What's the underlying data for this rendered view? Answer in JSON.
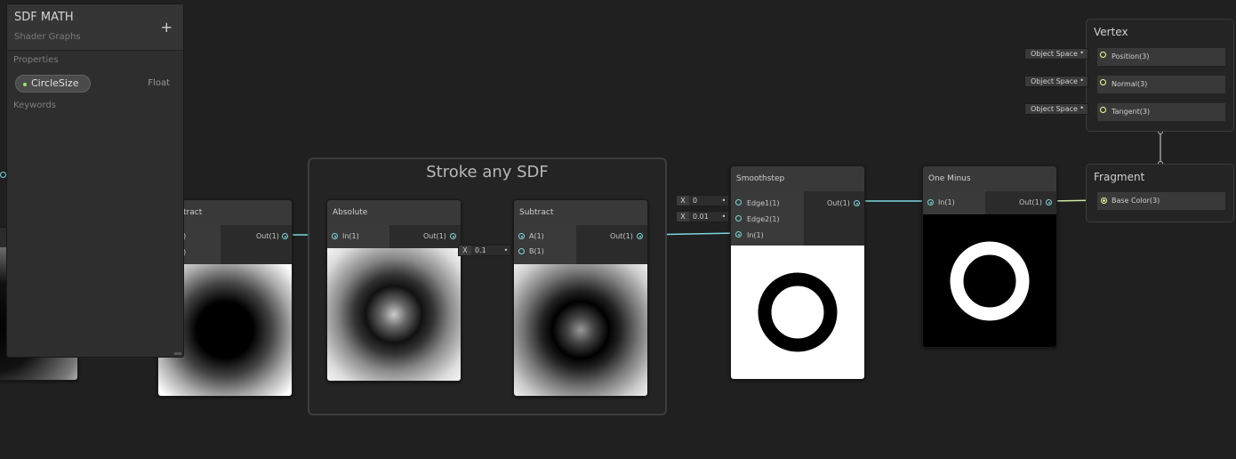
{
  "blackboard": {
    "title": "SDF MATH",
    "subtitle": "Shader Graphs",
    "add_label": "+",
    "properties_label": "Properties",
    "property": {
      "name": "CircleSize",
      "type": "Float"
    },
    "keywords_label": "Keywords"
  },
  "group": {
    "title": "Stroke any SDF"
  },
  "nodes": {
    "subtract1": {
      "title": "tract",
      "out": "Out(1)",
      "in_a": ")",
      "in_b": ")"
    },
    "absolute": {
      "title": "Absolute",
      "in": "In(1)",
      "out": "Out(1)"
    },
    "subtract2": {
      "title": "Subtract",
      "in_a": "A(1)",
      "in_b": "B(1)",
      "out": "Out(1)",
      "b_field": {
        "axis": "X",
        "value": "0.1"
      }
    },
    "smoothstep": {
      "title": "Smoothstep",
      "edge1": "Edge1(1)",
      "edge2": "Edge2(1)",
      "in": "In(1)",
      "out": "Out(1)",
      "edge1_field": {
        "axis": "X",
        "value": "0"
      },
      "edge2_field": {
        "axis": "X",
        "value": "0.01"
      }
    },
    "one_minus": {
      "title": "One Minus",
      "in": "In(1)",
      "out": "Out(1)"
    }
  },
  "master": {
    "vertex": {
      "title": "Vertex",
      "slots": [
        {
          "label": "Position(3)",
          "space": "Object Space"
        },
        {
          "label": "Normal(3)",
          "space": "Object Space"
        },
        {
          "label": "Tangent(3)",
          "space": "Object Space"
        }
      ]
    },
    "fragment": {
      "title": "Fragment",
      "slots": [
        {
          "label": "Base Color(3)"
        }
      ]
    }
  },
  "colors": {
    "float_port": "#7fd6dc",
    "vector3_port": "#f6ff9a",
    "property_dot": "#9be36b",
    "background": "#202020"
  }
}
